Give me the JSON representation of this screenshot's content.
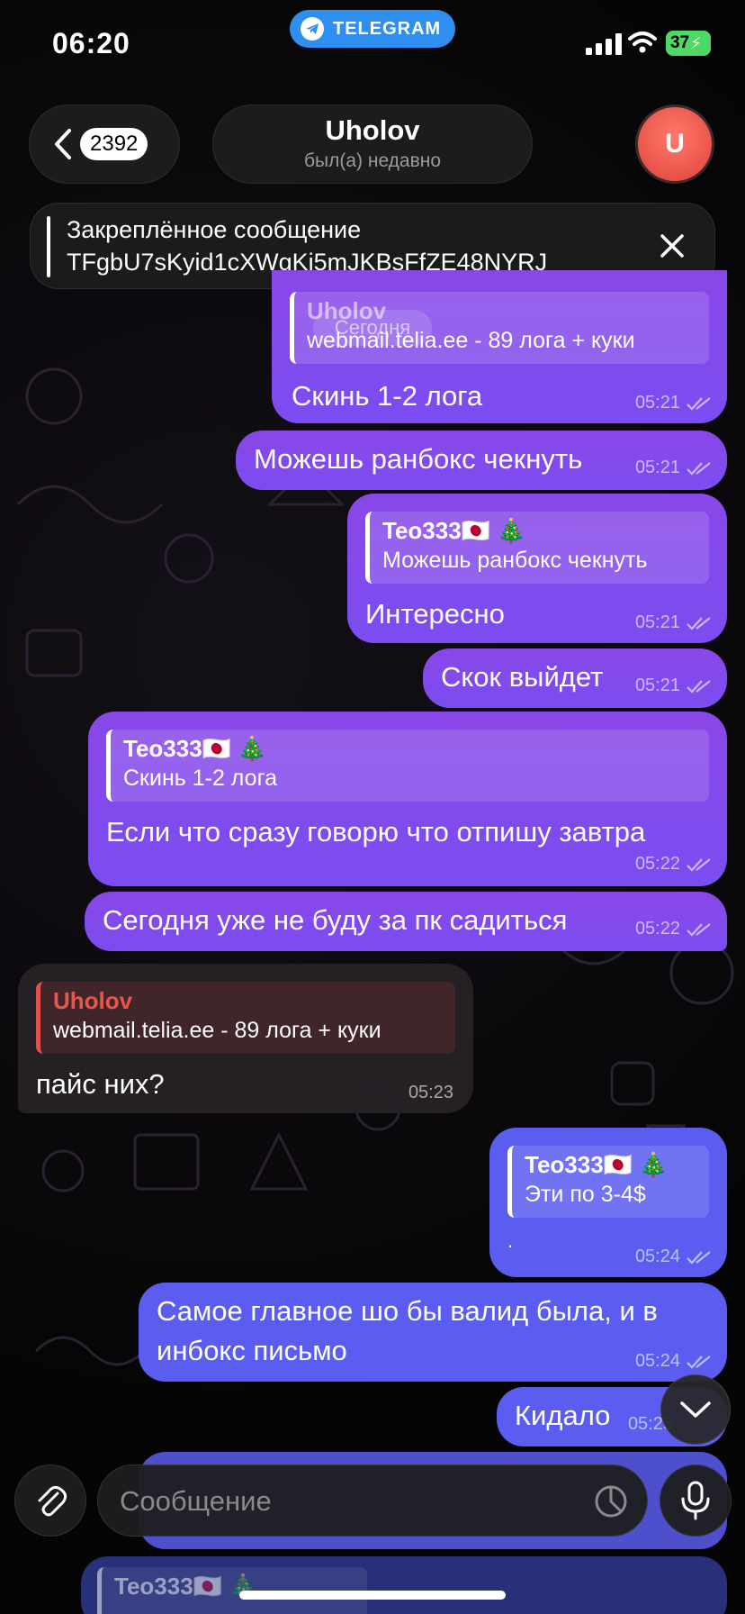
{
  "status_bar": {
    "time": "06:20",
    "app_pill": "TELEGRAM",
    "battery": "37"
  },
  "header": {
    "back_count": "2392",
    "title": "Uholov",
    "subtitle": "был(а) недавно",
    "avatar_letter": "U"
  },
  "pinned": {
    "label": "Закреплённое сообщение",
    "text": "TFgbU7sKyid1cXWgKi5mJKBsFfZE48NYRJ"
  },
  "date_pill": "Сегодня",
  "messages": [
    {
      "quote_name": "Uholov",
      "quote_text": "webmail.telia.ee - 89 лога + куки",
      "text": "Скинь 1-2 лога",
      "time": "05:21"
    },
    {
      "text": "Можешь ранбокс чекнуть",
      "time": "05:21"
    },
    {
      "quote_name": "Teo333🇯🇵 🎄",
      "quote_text": "Можешь ранбокс чекнуть",
      "text": "Интересно",
      "time": "05:21"
    },
    {
      "text": "Скок выйдет",
      "time": "05:21"
    },
    {
      "quote_name": "Teo333🇯🇵 🎄",
      "quote_text": "Скинь 1-2 лога",
      "text": "Если что сразу говорю что отпишу завтра",
      "time": "05:22"
    },
    {
      "text": "Сегодня уже не буду за пк садиться",
      "time": "05:22"
    },
    {
      "quote_name": "Uholov",
      "quote_text": "webmail.telia.ee - 89 лога + куки",
      "text": "пайс них?",
      "time": "05:23"
    },
    {
      "quote_name": "Teo333🇯🇵 🎄",
      "quote_text": "Эти по 3-4$",
      "text": ".",
      "time": "05:24"
    },
    {
      "text_line1": "Самое главное шо бы валид была, и в",
      "text_line2": "инбокс письмо",
      "time": "05:24"
    },
    {
      "text": "Кидало",
      "time": "05:25"
    }
  ],
  "bottom_quote_name": "Teo333🇯🇵 🎄",
  "composer": {
    "placeholder": "Сообщение"
  },
  "colors": {
    "outgoing": "#8a47e8",
    "outgoing_blue": "#5b5df0",
    "incoming": "#262226",
    "accent": "#2f8ff0",
    "incoming_quote": "#e8564e"
  }
}
